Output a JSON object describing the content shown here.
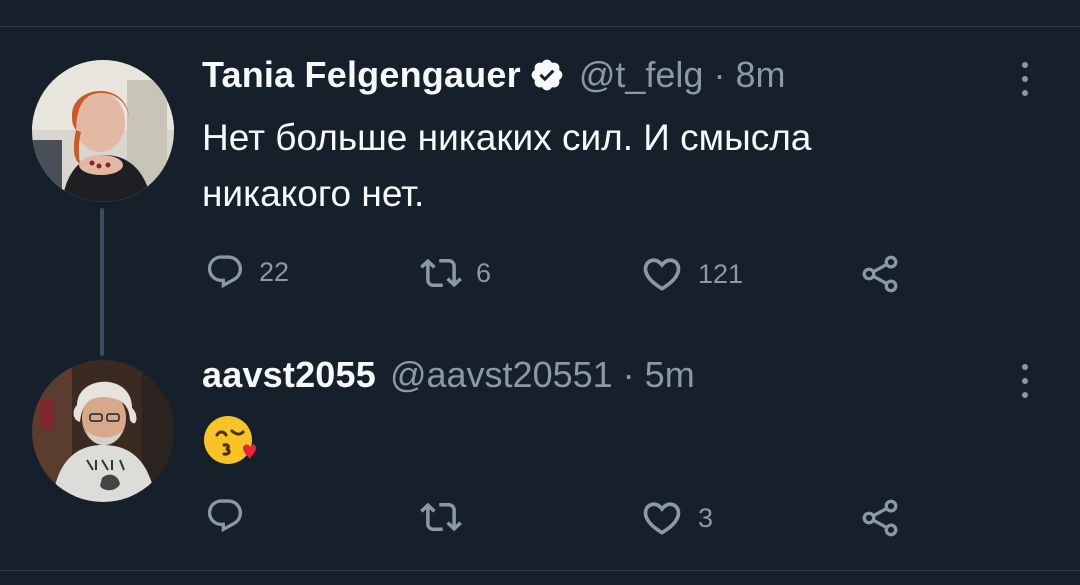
{
  "tweets": [
    {
      "display_name": "Tania Felgengauer",
      "verified": true,
      "handle": "@t_felg",
      "separator": "·",
      "time": "8m",
      "text_line1": "Нет больше никаких сил. И смысла",
      "text_line2": "никакого нет.",
      "replies": "22",
      "retweets": "6",
      "likes": "121"
    },
    {
      "display_name": "aavst2055",
      "verified": false,
      "handle": "@aavst20551",
      "separator": "·",
      "time": "5m",
      "emoji": "face-throwing-a-kiss-emoji",
      "replies": "",
      "retweets": "",
      "likes": "3"
    }
  ],
  "icons": {
    "reply": "reply-icon",
    "retweet": "retweet-icon",
    "like": "heart-icon",
    "share": "share-icon",
    "more": "more-icon",
    "verified": "verified-badge-icon"
  },
  "colors": {
    "background": "#15202b",
    "primary_text": "#f7f9f9",
    "secondary_text": "#8b98a5",
    "thread_line": "#3c4d5c"
  }
}
